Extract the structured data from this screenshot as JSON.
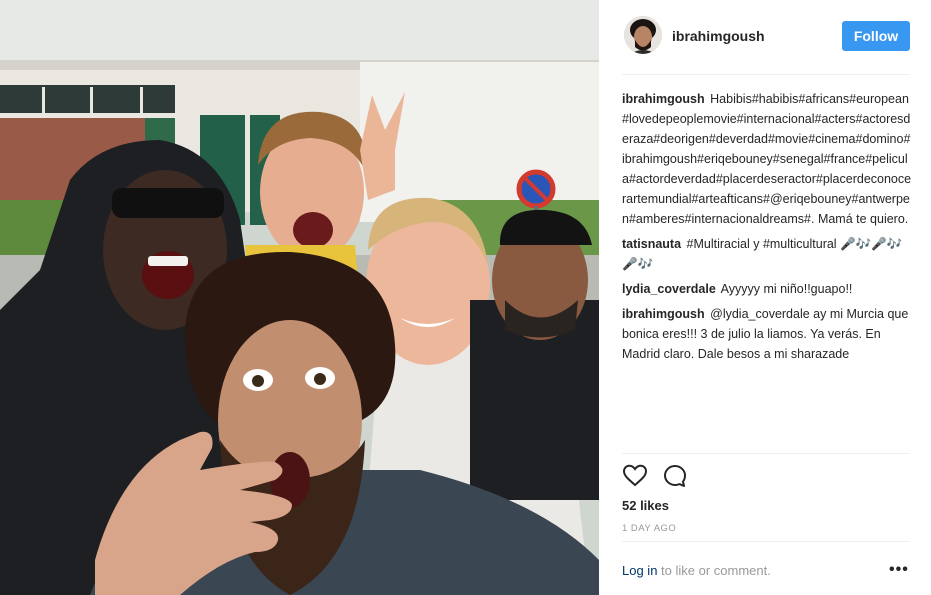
{
  "post": {
    "username": "ibrahimgoush",
    "follow_label": "Follow",
    "likes": "52 likes",
    "time_ago": "1 DAY AGO",
    "login_link": "Log in",
    "login_suffix": " to like or comment.",
    "more_label": "•••"
  },
  "comments": [
    {
      "user": "ibrahimgoush",
      "text": "Habibis#habibis#africans#european#lovedepeoplemovie#internacional#acters#actoresderaza#deorigen#deverdad#movie#cinema#domino#ibrahimgoush#eriqebouney#senegal#france#pelicula#actordeverdad#placerdeseractor#placerdeconocerartemundial#arteafticans#@eriqebouney#antwerpen#amberes#internacionaldreams#. Mamá te quiero."
    },
    {
      "user": "tatisnauta",
      "text": "#Multiracial y #multicultural 🎤🎶🎤🎶🎤🎶"
    },
    {
      "user": "lydia_coverdale",
      "text": "Ayyyyy mi niño!!guapo!!"
    },
    {
      "user": "ibrahimgoush",
      "text": "@lydia_coverdale ay mi Murcia que bonica eres!!! 3 de julio la liamos. Ya verás. En Madrid claro. Dale besos a mi sharazade"
    }
  ],
  "icons": {
    "like": "heart-icon",
    "comment": "comment-icon",
    "more": "more-options-icon"
  },
  "colors": {
    "follow_button": "#3897f0",
    "login_link": "#003569",
    "muted_text": "#999999"
  }
}
